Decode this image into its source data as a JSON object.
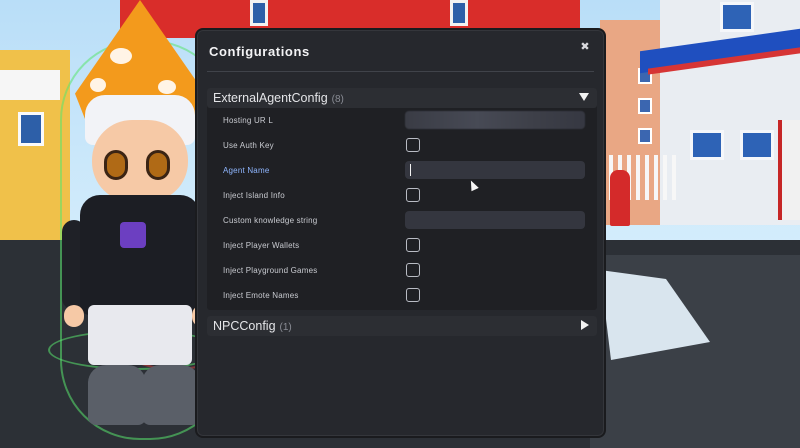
{
  "dialog": {
    "title": "Configurations",
    "close_icon": "close-icon",
    "sections": [
      {
        "name": "ExternalAgentConfig",
        "count": "(8)",
        "expanded": true,
        "fields": [
          {
            "label": "Hosting UR L",
            "type": "text",
            "value": ""
          },
          {
            "label": "Use Auth Key",
            "type": "checkbox",
            "checked": false
          },
          {
            "label": "Agent Name",
            "type": "text",
            "value": "",
            "focused": true
          },
          {
            "label": "Inject Island Info",
            "type": "checkbox",
            "checked": false
          },
          {
            "label": "Custom knowledge string",
            "type": "text",
            "value": ""
          },
          {
            "label": "Inject Player Wallets",
            "type": "checkbox",
            "checked": false
          },
          {
            "label": "Inject Playground Games",
            "type": "checkbox",
            "checked": false
          },
          {
            "label": "Inject Emote Names",
            "type": "checkbox",
            "checked": false
          }
        ]
      },
      {
        "name": "NPCConfig",
        "count": "(1)",
        "expanded": false
      }
    ]
  },
  "colors": {
    "dialog_bg": "#26282d",
    "row_bg": "#1f2024",
    "header_bg": "#2c2e33",
    "active_label": "#8fb6ff",
    "input_bg": "#34363f"
  }
}
